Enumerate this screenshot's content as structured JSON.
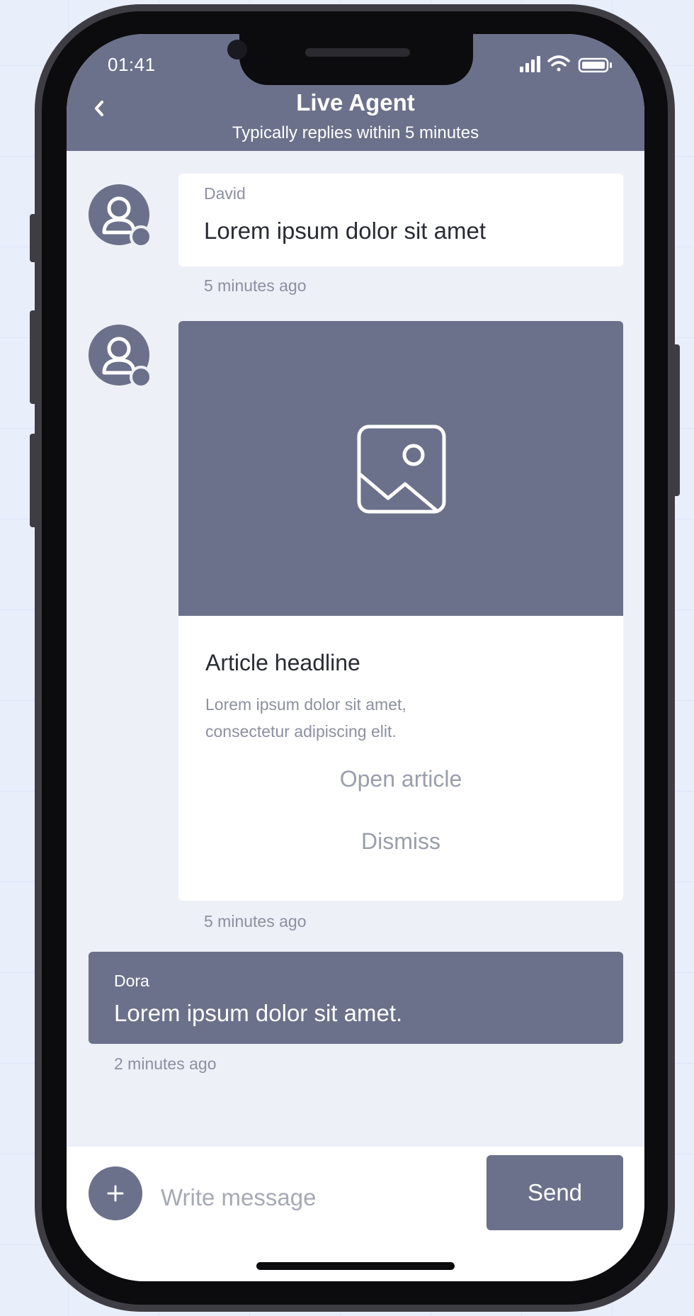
{
  "status_bar": {
    "time": "01:41"
  },
  "header": {
    "title": "Live Agent",
    "subtitle": "Typically replies within 5 minutes"
  },
  "messages": [
    {
      "sender": "David",
      "text": "Lorem ipsum dolor sit amet",
      "time": "5 minutes ago"
    },
    {
      "type": "article_card",
      "headline": "Article headline",
      "description_line1": "Lorem ipsum dolor sit amet,",
      "description_line2": "consectetur adipiscing elit.",
      "open_label": "Open article",
      "dismiss_label": "Dismiss",
      "time": "5 minutes ago"
    },
    {
      "sender": "Dora",
      "text": "Lorem ipsum dolor sit amet.",
      "time": "2 minutes ago"
    }
  ],
  "composer": {
    "placeholder": "Write message",
    "value": "",
    "send_label": "Send"
  },
  "colors": {
    "accent": "#6b718a",
    "background": "#edf0f6",
    "page_background": "#e9eefb"
  },
  "icons": [
    "chevron-left-icon",
    "signal-icon",
    "wifi-icon",
    "battery-icon",
    "user-avatar-icon",
    "image-placeholder-icon",
    "plus-icon"
  ]
}
